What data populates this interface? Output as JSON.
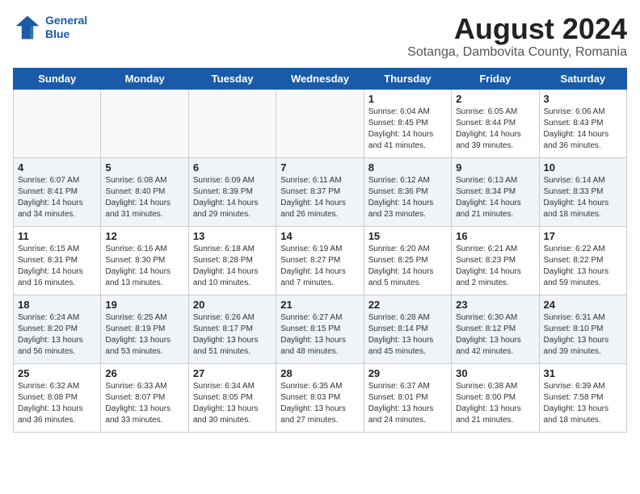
{
  "header": {
    "logo_line1": "General",
    "logo_line2": "Blue",
    "title": "August 2024",
    "subtitle": "Sotanga, Dambovita County, Romania"
  },
  "days_of_week": [
    "Sunday",
    "Monday",
    "Tuesday",
    "Wednesday",
    "Thursday",
    "Friday",
    "Saturday"
  ],
  "weeks": [
    [
      {
        "day": "",
        "info": ""
      },
      {
        "day": "",
        "info": ""
      },
      {
        "day": "",
        "info": ""
      },
      {
        "day": "",
        "info": ""
      },
      {
        "day": "1",
        "info": "Sunrise: 6:04 AM\nSunset: 8:45 PM\nDaylight: 14 hours\nand 41 minutes."
      },
      {
        "day": "2",
        "info": "Sunrise: 6:05 AM\nSunset: 8:44 PM\nDaylight: 14 hours\nand 39 minutes."
      },
      {
        "day": "3",
        "info": "Sunrise: 6:06 AM\nSunset: 8:43 PM\nDaylight: 14 hours\nand 36 minutes."
      }
    ],
    [
      {
        "day": "4",
        "info": "Sunrise: 6:07 AM\nSunset: 8:41 PM\nDaylight: 14 hours\nand 34 minutes."
      },
      {
        "day": "5",
        "info": "Sunrise: 6:08 AM\nSunset: 8:40 PM\nDaylight: 14 hours\nand 31 minutes."
      },
      {
        "day": "6",
        "info": "Sunrise: 6:09 AM\nSunset: 8:39 PM\nDaylight: 14 hours\nand 29 minutes."
      },
      {
        "day": "7",
        "info": "Sunrise: 6:11 AM\nSunset: 8:37 PM\nDaylight: 14 hours\nand 26 minutes."
      },
      {
        "day": "8",
        "info": "Sunrise: 6:12 AM\nSunset: 8:36 PM\nDaylight: 14 hours\nand 23 minutes."
      },
      {
        "day": "9",
        "info": "Sunrise: 6:13 AM\nSunset: 8:34 PM\nDaylight: 14 hours\nand 21 minutes."
      },
      {
        "day": "10",
        "info": "Sunrise: 6:14 AM\nSunset: 8:33 PM\nDaylight: 14 hours\nand 18 minutes."
      }
    ],
    [
      {
        "day": "11",
        "info": "Sunrise: 6:15 AM\nSunset: 8:31 PM\nDaylight: 14 hours\nand 16 minutes."
      },
      {
        "day": "12",
        "info": "Sunrise: 6:16 AM\nSunset: 8:30 PM\nDaylight: 14 hours\nand 13 minutes."
      },
      {
        "day": "13",
        "info": "Sunrise: 6:18 AM\nSunset: 8:28 PM\nDaylight: 14 hours\nand 10 minutes."
      },
      {
        "day": "14",
        "info": "Sunrise: 6:19 AM\nSunset: 8:27 PM\nDaylight: 14 hours\nand 7 minutes."
      },
      {
        "day": "15",
        "info": "Sunrise: 6:20 AM\nSunset: 8:25 PM\nDaylight: 14 hours\nand 5 minutes."
      },
      {
        "day": "16",
        "info": "Sunrise: 6:21 AM\nSunset: 8:23 PM\nDaylight: 14 hours\nand 2 minutes."
      },
      {
        "day": "17",
        "info": "Sunrise: 6:22 AM\nSunset: 8:22 PM\nDaylight: 13 hours\nand 59 minutes."
      }
    ],
    [
      {
        "day": "18",
        "info": "Sunrise: 6:24 AM\nSunset: 8:20 PM\nDaylight: 13 hours\nand 56 minutes."
      },
      {
        "day": "19",
        "info": "Sunrise: 6:25 AM\nSunset: 8:19 PM\nDaylight: 13 hours\nand 53 minutes."
      },
      {
        "day": "20",
        "info": "Sunrise: 6:26 AM\nSunset: 8:17 PM\nDaylight: 13 hours\nand 51 minutes."
      },
      {
        "day": "21",
        "info": "Sunrise: 6:27 AM\nSunset: 8:15 PM\nDaylight: 13 hours\nand 48 minutes."
      },
      {
        "day": "22",
        "info": "Sunrise: 6:28 AM\nSunset: 8:14 PM\nDaylight: 13 hours\nand 45 minutes."
      },
      {
        "day": "23",
        "info": "Sunrise: 6:30 AM\nSunset: 8:12 PM\nDaylight: 13 hours\nand 42 minutes."
      },
      {
        "day": "24",
        "info": "Sunrise: 6:31 AM\nSunset: 8:10 PM\nDaylight: 13 hours\nand 39 minutes."
      }
    ],
    [
      {
        "day": "25",
        "info": "Sunrise: 6:32 AM\nSunset: 8:08 PM\nDaylight: 13 hours\nand 36 minutes."
      },
      {
        "day": "26",
        "info": "Sunrise: 6:33 AM\nSunset: 8:07 PM\nDaylight: 13 hours\nand 33 minutes."
      },
      {
        "day": "27",
        "info": "Sunrise: 6:34 AM\nSunset: 8:05 PM\nDaylight: 13 hours\nand 30 minutes."
      },
      {
        "day": "28",
        "info": "Sunrise: 6:35 AM\nSunset: 8:03 PM\nDaylight: 13 hours\nand 27 minutes."
      },
      {
        "day": "29",
        "info": "Sunrise: 6:37 AM\nSunset: 8:01 PM\nDaylight: 13 hours\nand 24 minutes."
      },
      {
        "day": "30",
        "info": "Sunrise: 6:38 AM\nSunset: 8:00 PM\nDaylight: 13 hours\nand 21 minutes."
      },
      {
        "day": "31",
        "info": "Sunrise: 6:39 AM\nSunset: 7:58 PM\nDaylight: 13 hours\nand 18 minutes."
      }
    ]
  ]
}
